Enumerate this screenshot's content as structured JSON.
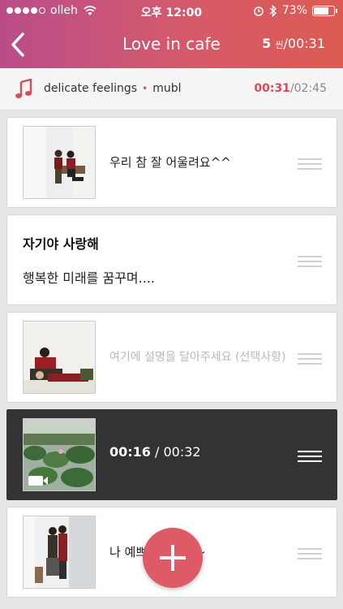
{
  "status_bar": {
    "carrier": "olleh",
    "time": "오후 12:00",
    "battery": "73%",
    "battery_level": 0.73,
    "signal_bars": 4
  },
  "nav": {
    "title": "Love in cafe",
    "scene_count": "5",
    "scene_unit": "씬",
    "total_time": "/00:31"
  },
  "music": {
    "song": "delicate feelings",
    "separator": "•",
    "artist": "mubl",
    "current_time": "00:31",
    "total_time": "/02:45",
    "accent": "#d94a5a"
  },
  "scenes": [
    {
      "type": "photo",
      "caption": "우리 참 잘 어울려요^^"
    },
    {
      "type": "text",
      "title": "자기야 사랑해",
      "body": "행복한 미래를 꿈꾸며...."
    },
    {
      "type": "photo",
      "caption": "여기에 설명을 달아주세요 (선택사항)"
    },
    {
      "type": "video",
      "current": "00:16",
      "total": " / 00:32"
    },
    {
      "type": "photo",
      "caption": "나 예쁘게 찍어줘~"
    }
  ],
  "fab": {
    "icon": "plus-icon",
    "color": "#dd5a66"
  }
}
